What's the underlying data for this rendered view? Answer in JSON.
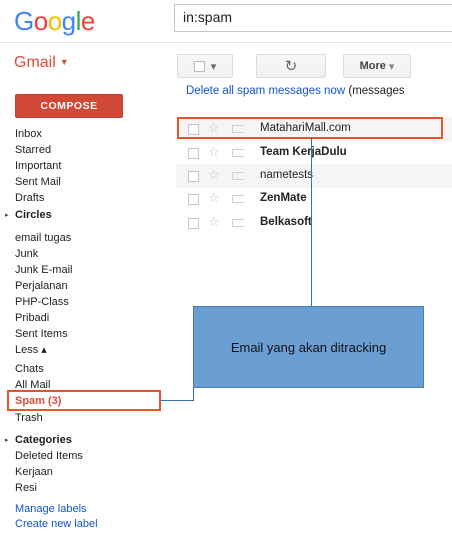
{
  "header": {
    "logo_letters": [
      {
        "ch": "G",
        "color": "#4285f4"
      },
      {
        "ch": "o",
        "color": "#ea4335"
      },
      {
        "ch": "o",
        "color": "#fbbc05"
      },
      {
        "ch": "g",
        "color": "#4285f4"
      },
      {
        "ch": "l",
        "color": "#34a853"
      },
      {
        "ch": "e",
        "color": "#ea4335"
      }
    ],
    "search_value": "in:spam"
  },
  "app_label": "Gmail",
  "toolbar": {
    "select_caret": "▾",
    "refresh_icon": "↻",
    "more_label": "More",
    "more_caret": "▾"
  },
  "compose_label": "COMPOSE",
  "sidebar": {
    "items": [
      {
        "label": "Inbox"
      },
      {
        "label": "Starred"
      },
      {
        "label": "Important"
      },
      {
        "label": "Sent Mail"
      },
      {
        "label": "Drafts"
      },
      {
        "label": "Circles",
        "bold": true,
        "arrow": true
      },
      {
        "label": "email tugas"
      },
      {
        "label": "Junk"
      },
      {
        "label": "Junk E-mail"
      },
      {
        "label": "Perjalanan"
      },
      {
        "label": "PHP-Class"
      },
      {
        "label": "Pribadi"
      },
      {
        "label": "Sent Items"
      },
      {
        "label": "Less ▴"
      },
      {
        "label": "Chats"
      },
      {
        "label": "All Mail"
      },
      {
        "label": "Spam (3)",
        "highlight": true
      },
      {
        "label": "Trash"
      },
      {
        "label": "Categories",
        "bold": true,
        "arrow": true
      },
      {
        "label": "Deleted Items"
      },
      {
        "label": "Kerjaan"
      },
      {
        "label": "Resi"
      },
      {
        "label": "Manage labels",
        "link": true
      },
      {
        "label": "Create new label",
        "link": true
      }
    ]
  },
  "spam_notice": {
    "link": "Delete all spam messages now",
    "rest": " (messages"
  },
  "messages": [
    {
      "sender": "MatahariMall.com",
      "unread": false,
      "highlighted": true
    },
    {
      "sender": "Team KerjaDulu",
      "unread": true
    },
    {
      "sender": "nametests",
      "unread": false
    },
    {
      "sender": "ZenMate",
      "unread": true
    },
    {
      "sender": "Belkasoft",
      "unread": true
    }
  ],
  "callout_text": "Email yang akan ditracking",
  "colors": {
    "accent_red": "#dd4b39",
    "compose_red": "#d14836",
    "highlight_orange": "#e8542a",
    "callout_blue": "#6b9fd4",
    "link_blue": "#1155cc"
  }
}
